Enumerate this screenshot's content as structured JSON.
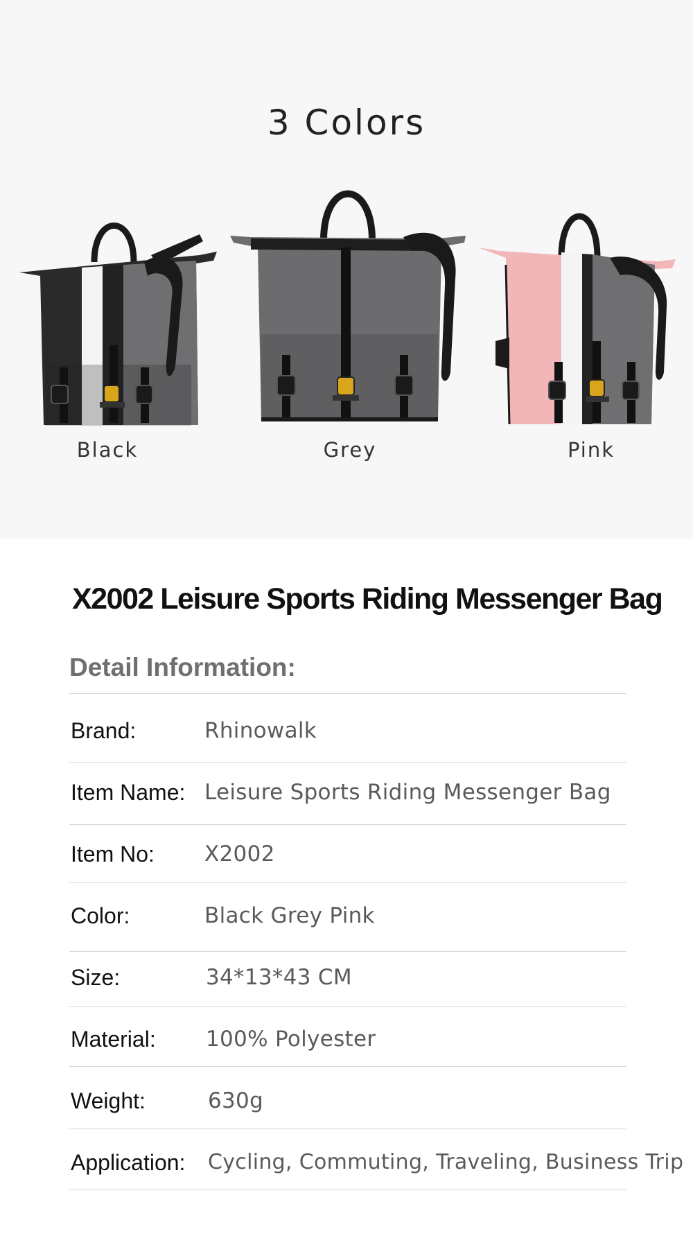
{
  "colors_section": {
    "title": "3 Colors",
    "variants": [
      {
        "label": "Black",
        "body": "#2a2a2a",
        "accent": "#ffffff",
        "side": "#6f6e71"
      },
      {
        "label": "Grey",
        "body": "#6c6b6e",
        "accent": "#2a2a2a",
        "side": "#6c6b6e"
      },
      {
        "label": "Pink",
        "body": "#f2b5b8",
        "accent": "#ffffff",
        "side": "#6f6e71"
      }
    ]
  },
  "product": {
    "title": "X2002 Leisure Sports Riding Messenger Bag",
    "subtitle": "Detail Information:"
  },
  "specs": [
    {
      "key": "Brand:",
      "value": "Rhinowalk"
    },
    {
      "key": "Item Name:",
      "value": "Leisure Sports Riding Messenger Bag"
    },
    {
      "key": "Item No:",
      "value": "X2002"
    },
    {
      "key": "Color:",
      "value": "Black Grey Pink"
    },
    {
      "key": "Size:",
      "value": "34*13*43 CM"
    },
    {
      "key": "Material:",
      "value": "100% Polyester"
    },
    {
      "key": "Weight:",
      "value": "630g"
    },
    {
      "key": "Application:",
      "value": "Cycling, Commuting, Traveling, Business Trip"
    }
  ]
}
